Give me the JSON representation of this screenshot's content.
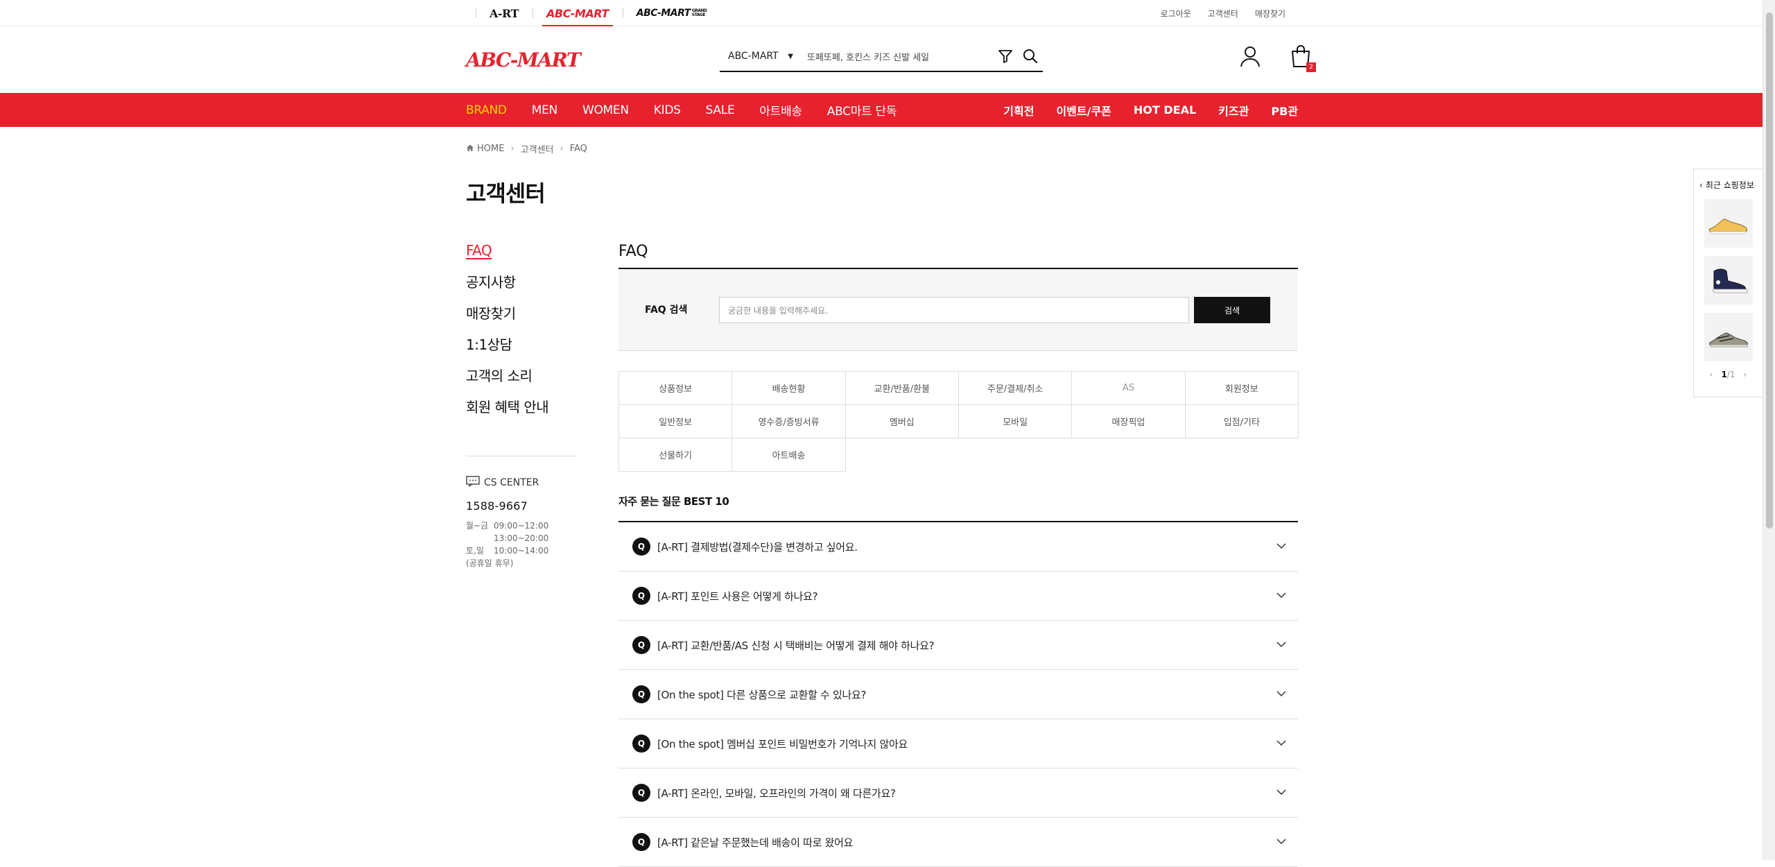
{
  "topbar": {
    "brand_tabs": [
      "A-RT",
      "ABC-MART",
      "ABC-MART"
    ],
    "brand_tab_small": "GRAND STAGE",
    "util_links": [
      "로그아웃",
      "고객센터",
      "매장찾기"
    ]
  },
  "header": {
    "logo": "ABC-MART",
    "search_select": "ABC-MART",
    "search_placeholder": "또페또페, 호킨스 키즈 신발 세일",
    "cart_count": "2"
  },
  "gnb": {
    "left": [
      "BRAND",
      "MEN",
      "WOMEN",
      "KIDS",
      "SALE",
      "아트배송",
      "ABC마트 단독"
    ],
    "right": [
      "기획전",
      "이벤트/쿠폰",
      "HOT DEAL",
      "키즈관",
      "PB관"
    ]
  },
  "breadcrumb": [
    "HOME",
    "고객센터",
    "FAQ"
  ],
  "page_title": "고객센터",
  "lnb": [
    "FAQ",
    "공지사항",
    "매장찾기",
    "1:1상담",
    "고객의 소리",
    "회원 혜택 안내"
  ],
  "cs": {
    "title": "CS CENTER",
    "phone": "1588-9667",
    "hours": [
      {
        "k": "월~금",
        "v": "09:00~12:00"
      },
      {
        "k": "",
        "v": "13:00~20:00"
      },
      {
        "k": "토,일",
        "v": "10:00~14:00"
      }
    ],
    "note": "(공휴일 휴무)"
  },
  "main": {
    "title": "FAQ",
    "search_label": "FAQ 검색",
    "search_placeholder": "궁금한 내용을 입력해주세요.",
    "search_button": "검색",
    "categories": [
      "상품정보",
      "배송현황",
      "교환/반품/환불",
      "주문/결제/취소",
      "AS",
      "회원정보",
      "일반정보",
      "영수증/증빙서류",
      "멤버십",
      "모바일",
      "매장픽업",
      "입점/기타",
      "선물하기",
      "아트배송"
    ],
    "best_title": "자주 묻는 질문 BEST 10",
    "q_mark": "Q",
    "faqs": [
      "[A-RT] 결제방법(결제수단)을 변경하고 싶어요.",
      "[A-RT] 포인트 사용은 어떻게 하나요?",
      "[A-RT] 교환/반품/AS 신청 시 택배비는 어떻게 결제 해야 하나요?",
      "[On the spot] 다른 상품으로 교환할 수 있나요?",
      "[On the spot] 멤버십 포인트 비밀번호가 기억나지 않아요",
      "[A-RT] 온라인, 모바일, 오프라인의 가격이 왜 다른가요?",
      "[A-RT] 같은날 주문했는데 배송이 따로 왔어요"
    ]
  },
  "recent": {
    "title": "최근 쇼핑정보",
    "page_current": "1",
    "page_total": "/1",
    "thumbs": [
      "yellow-sneaker",
      "navy-high-top",
      "grey-runner"
    ]
  },
  "colors": {
    "accent": "#e8212e",
    "brand_highlight": "#ffd200",
    "dark": "#111111"
  }
}
